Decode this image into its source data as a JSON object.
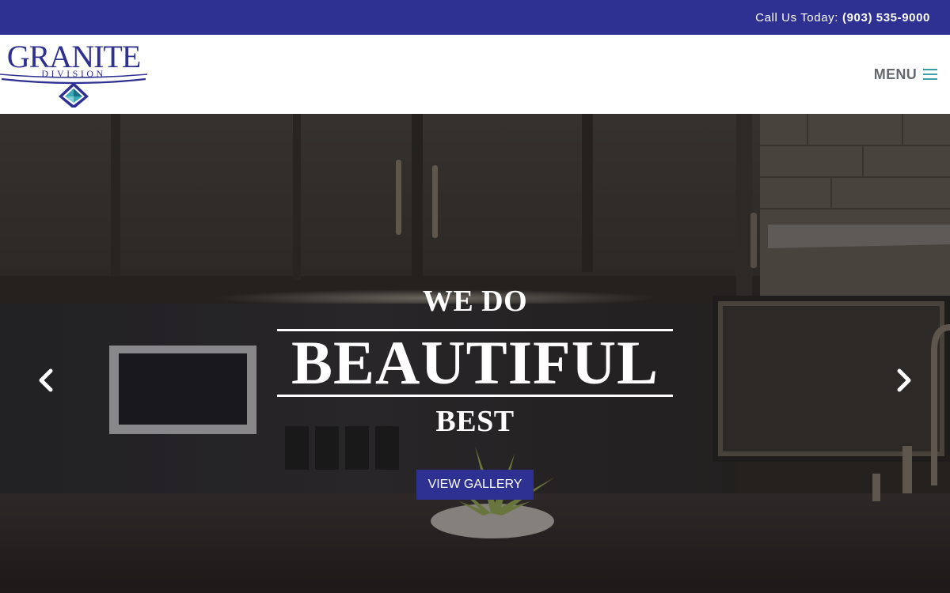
{
  "topbar": {
    "call_label": "Call Us Today:",
    "phone": "(903) 535-9000"
  },
  "header": {
    "logo": {
      "name": "GRANITE",
      "subtitle": "DIVISION",
      "icon": "granite-g-diamond-logo"
    },
    "menu_label": "MENU",
    "menu_icon": "hamburger-icon"
  },
  "hero": {
    "line1": "WE DO",
    "line2": "BEAUTIFUL",
    "line3": "BEST",
    "cta_label": "VIEW GALLERY",
    "prev_icon": "chevron-left-icon",
    "next_icon": "chevron-right-icon"
  },
  "colors": {
    "brand_blue": "#2e3192",
    "accent_teal": "#3a9ea5",
    "menu_gray": "#666a70"
  }
}
